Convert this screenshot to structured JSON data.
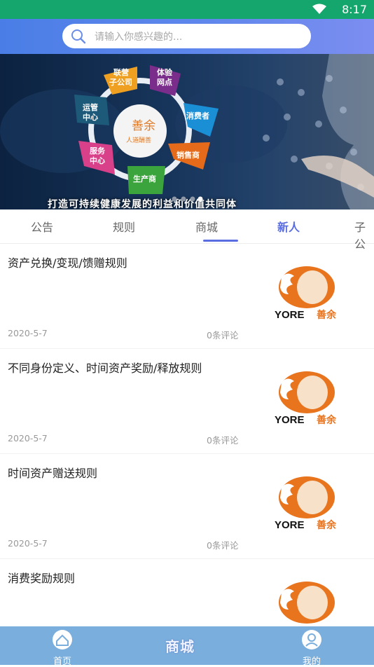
{
  "status": {
    "time": "8:17"
  },
  "search": {
    "placeholder": "请输入你感兴趣的..."
  },
  "banner": {
    "caption": "打造可持续健康发展的利益和价值共同体",
    "center_title": "善余",
    "center_subtitle": "人道酬善",
    "nodes": [
      "联营子公司",
      "体验网点",
      "消费者",
      "销售商",
      "生产商",
      "服务中心",
      "运管中心"
    ]
  },
  "tabs": [
    {
      "label": "公告",
      "active": false
    },
    {
      "label": "规则",
      "active": false
    },
    {
      "label": "商城",
      "active": false
    },
    {
      "label": "新人",
      "active": true
    },
    {
      "label": "子公",
      "active": false
    }
  ],
  "items": [
    {
      "title": "资产兑换/变现/馈赠规则",
      "date": "2020-5-7",
      "comments": "0条评论"
    },
    {
      "title": "不同身份定义、时间资产奖励/释放规则",
      "date": "2020-5-7",
      "comments": "0条评论"
    },
    {
      "title": "时间资产赠送规则",
      "date": "2020-5-7",
      "comments": "0条评论"
    },
    {
      "title": "消费奖励规则",
      "date": "",
      "comments": ""
    }
  ],
  "logo": {
    "en": "YORE",
    "cn": "善余"
  },
  "bottom_nav": {
    "home": "首页",
    "center": "商城",
    "mine": "我的"
  },
  "colors": {
    "status_bar": "#15a66d",
    "accent": "#5b6ee1",
    "bottom_nav": "#7aaedc",
    "logo_orange": "#e8741e"
  }
}
